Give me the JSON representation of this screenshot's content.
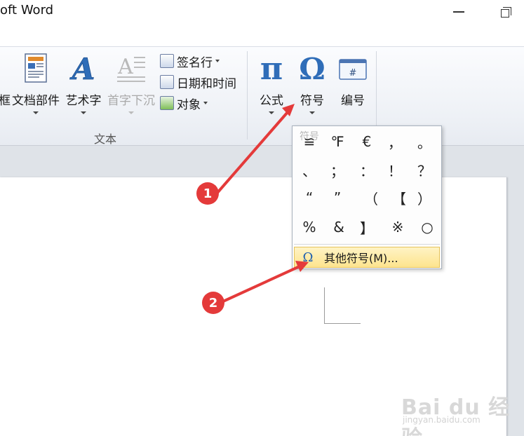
{
  "window": {
    "title": "oft Word"
  },
  "ribbon": {
    "buttons": [
      {
        "label": "框"
      },
      {
        "label": "文档部件"
      },
      {
        "label": "艺术字"
      },
      {
        "label": "首字下沉"
      },
      {
        "label": "公式"
      },
      {
        "label": "符号"
      },
      {
        "label": "编号"
      }
    ],
    "small_items": [
      {
        "label": "签名行",
        "icon": "signature-line-icon"
      },
      {
        "label": "日期和时间",
        "icon": "date-time-icon"
      },
      {
        "label": "对象",
        "icon": "object-icon"
      }
    ],
    "groups": [
      {
        "label": "文本"
      }
    ]
  },
  "symbol_menu": {
    "heading": "符号",
    "symbols": [
      "≌",
      "℉",
      "€",
      "，",
      "。",
      "、",
      "；",
      "：",
      "！",
      "？",
      "“",
      "”",
      "（",
      "【",
      "）",
      "%",
      "&",
      "】",
      "※",
      "○"
    ],
    "more_label": "其他符号(M)..."
  },
  "annotations": {
    "step1": "1",
    "step2": "2"
  },
  "watermark": {
    "brand": "Bai du 经验",
    "url": "jingyan.baidu.com"
  },
  "colors": {
    "annotation_red": "#e43a3a",
    "highlight": "#fde48e",
    "icon_blue": "#1f5fb0"
  }
}
